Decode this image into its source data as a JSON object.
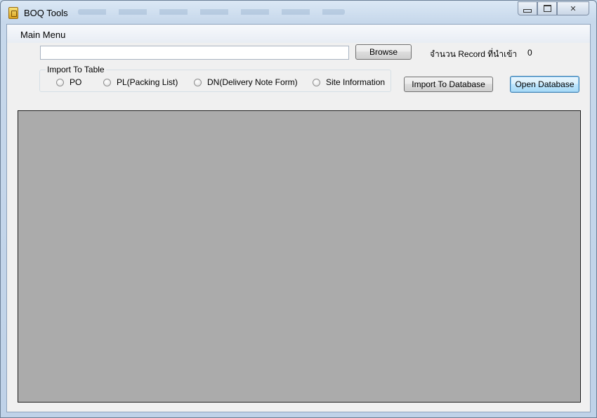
{
  "window": {
    "title": "BOQ Tools",
    "icon": "app-icon",
    "controls": {
      "minimize_icon": "minimize-icon",
      "maximize_icon": "maximize-icon",
      "close_glyph": "✕"
    }
  },
  "menubar": {
    "items": [
      {
        "label": "Main Menu"
      }
    ]
  },
  "file_picker": {
    "path_value": "",
    "browse_label": "Browse"
  },
  "records": {
    "label": "จำนวน Record ที่นำเข้า",
    "count": "0"
  },
  "import_group": {
    "legend": "Import To Table",
    "options": [
      {
        "label": "PO",
        "checked": false
      },
      {
        "label": "PL(Packing List)",
        "checked": false
      },
      {
        "label": "DN(Delivery Note Form)",
        "checked": false
      },
      {
        "label": "Site Information",
        "checked": false
      }
    ]
  },
  "actions": {
    "import_label": "Import To Database",
    "open_label": "Open Database"
  },
  "colors": {
    "grid_background": "#ababab",
    "client_background": "#f0f0f0",
    "focused_button_border": "#3c7fb1"
  }
}
